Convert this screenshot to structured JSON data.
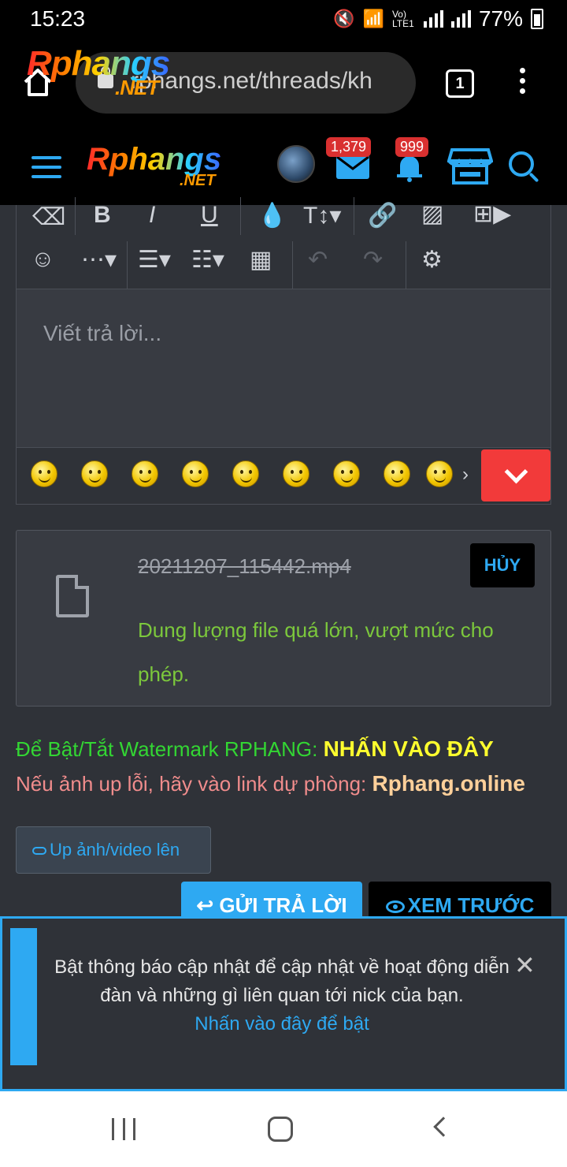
{
  "statusbar": {
    "time": "15:23",
    "network": "Vo) LTE1",
    "battery": "77%"
  },
  "browser": {
    "url": "rphangs.net/threads/kh",
    "tab_count": "1"
  },
  "site": {
    "logo_text": "Rphangs",
    "logo_suffix": ".NET",
    "messages_badge": "1,379",
    "alerts_badge": "999"
  },
  "editor": {
    "placeholder": "Viết trả lời...",
    "smilies_count": 9
  },
  "attachment": {
    "filename": "20211207_115442.mp4",
    "error": "Dung lượng file quá lớn, vượt mức cho phép.",
    "cancel_label": "HỦY"
  },
  "watermark": {
    "line1_text": "Để Bật/Tắt Watermark RPHANG: ",
    "line1_link": "NHẤN VÀO ĐÂY",
    "line2_text": "Nếu ảnh up lỗi, hãy vào link dự phòng: ",
    "line2_link": "Rphang.online"
  },
  "actions": {
    "upload_label": "Up ảnh/video lên",
    "reply_label": "GỬI TRẢ LỜI",
    "preview_label": "XEM TRƯỚC"
  },
  "notice": {
    "message": "Bật thông báo cập nhật để cập nhật về hoạt động diễn đàn và những gì liên quan tới nick của bạn.",
    "link": "Nhấn vào đây để bật"
  },
  "colors": {
    "accent": "#2ea9f2",
    "danger": "#f23a3a",
    "success_text": "#7cc83c",
    "highlight": "#ffff2e"
  }
}
